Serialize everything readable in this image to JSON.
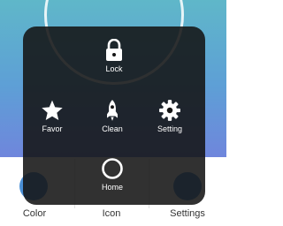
{
  "overlay_menu": {
    "lock_label": "Lock",
    "favor_label": "Favor",
    "clean_label": "Clean",
    "setting_label": "Setting",
    "home_label": "Home"
  },
  "bottom_bar": {
    "items": [
      {
        "label": "Color",
        "icon": "palette-icon"
      },
      {
        "label": "Icon",
        "icon": "icon-icon"
      },
      {
        "label": "Settings",
        "icon": "settings-icon"
      }
    ]
  },
  "colors": {
    "gradient_top": "#5fb7c9",
    "gradient_bottom": "#6f86dc",
    "overlay_bg": "#141414",
    "accent": "#4a8fd6"
  }
}
